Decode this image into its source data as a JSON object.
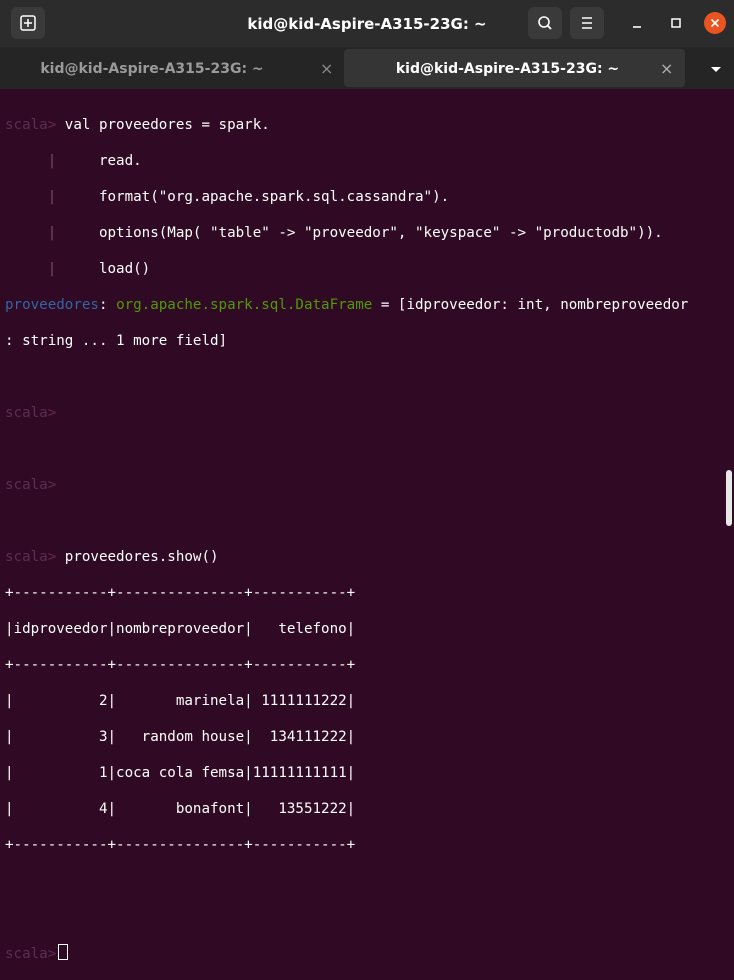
{
  "window": {
    "title": "kid@kid-Aspire-A315-23G: ~"
  },
  "tabs": [
    {
      "label": "kid@kid-Aspire-A315-23G: ~",
      "active": false
    },
    {
      "label": "kid@kid-Aspire-A315-23G: ~",
      "active": true
    }
  ],
  "icons": {
    "new_tab": "new-tab-icon",
    "search": "search-icon",
    "menu": "hamburger-menu-icon",
    "minimize": "minimize-icon",
    "maximize": "maximize-icon",
    "close": "close-icon",
    "tab_close": "×",
    "tabs_dropdown": "chevron-down-icon"
  },
  "colors": {
    "terminal_bg": "#300a24",
    "close_button": "#e95420",
    "prompt": "#5e2c50",
    "type_name": "#3465a4",
    "type_value": "#4e9a06"
  },
  "terminal": {
    "prompt": "scala>",
    "cmd1": {
      "line1": " val proveedores = spark.",
      "cont_prefix": "     |",
      "line2": "     read.",
      "line3": "     format(\"org.apache.spark.sql.cassandra\").",
      "line4": "     options(Map( \"table\" -> \"proveedor\", \"keyspace\" -> \"productodb\")).",
      "line5": "     load()"
    },
    "result": {
      "var_name": "proveedores",
      "colon": ": ",
      "type": "org.apache.spark.sql.DataFrame",
      "value_a": " = [idproveedor: int, nombreproveedor",
      "value_b": ": string ... 1 more field]"
    },
    "cmd2": " proveedores.show()",
    "table": {
      "border": "+-----------+---------------+-----------+",
      "header": "|idproveedor|nombreproveedor|   telefono|",
      "rows": [
        "|          2|       marinela| 1111111222|",
        "|          3|   random house|  134111222|",
        "|          1|coca cola femsa|11111111111|",
        "|          4|       bonafont|   13551222|"
      ]
    }
  }
}
